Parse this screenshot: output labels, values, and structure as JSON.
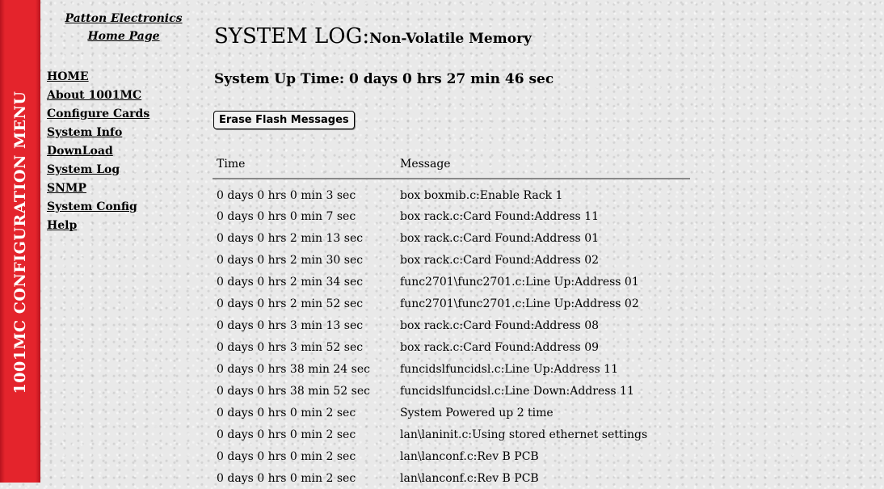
{
  "sidebar": {
    "banner": "1001MC CONFIGURATION MENU",
    "home_link_line1": "Patton Electronics",
    "home_link_line2": "Home Page",
    "nav_items": [
      {
        "label": "HOME"
      },
      {
        "label": "About 1001MC"
      },
      {
        "label": "Configure Cards"
      },
      {
        "label": "System Info"
      },
      {
        "label": "DownLoad"
      },
      {
        "label": "System Log"
      },
      {
        "label": "SNMP"
      },
      {
        "label": "System Config"
      },
      {
        "label": "Help"
      }
    ]
  },
  "main": {
    "title": "SYSTEM LOG:",
    "title_sub": "Non-Volatile Memory",
    "uptime": "System Up Time: 0 days 0 hrs 27 min 46 sec",
    "erase_button_label": "Erase Flash Messages",
    "table": {
      "headers": {
        "time": "Time",
        "message": "Message"
      },
      "rows": [
        {
          "time": "0 days 0 hrs 0 min 3 sec",
          "message": "box boxmib.c:Enable Rack 1"
        },
        {
          "time": "0 days 0 hrs 0 min 7 sec",
          "message": "box rack.c:Card Found:Address 11"
        },
        {
          "time": "0 days 0 hrs 2 min 13 sec",
          "message": "box rack.c:Card Found:Address 01"
        },
        {
          "time": "0 days 0 hrs 2 min 30 sec",
          "message": "box rack.c:Card Found:Address 02"
        },
        {
          "time": "0 days 0 hrs 2 min 34 sec",
          "message": "func2701\\func2701.c:Line Up:Address 01"
        },
        {
          "time": "0 days 0 hrs 2 min 52 sec",
          "message": "func2701\\func2701.c:Line Up:Address 02"
        },
        {
          "time": "0 days 0 hrs 3 min 13 sec",
          "message": "box rack.c:Card Found:Address 08"
        },
        {
          "time": "0 days 0 hrs 3 min 52 sec",
          "message": "box rack.c:Card Found:Address 09"
        },
        {
          "time": "0 days 0 hrs 38 min 24 sec",
          "message": "funcidslfuncidsl.c:Line Up:Address 11"
        },
        {
          "time": "0 days 0 hrs 38 min 52 sec",
          "message": "funcidslfuncidsl.c:Line Down:Address 11"
        },
        {
          "time": "0 days 0 hrs 0 min 2 sec",
          "message": "System Powered up 2 time"
        },
        {
          "time": "0 days 0 hrs 0 min 2 sec",
          "message": "lan\\laninit.c:Using stored ethernet settings"
        },
        {
          "time": "0 days 0 hrs 0 min 2 sec",
          "message": "lan\\lanconf.c:Rev B PCB"
        },
        {
          "time": "0 days 0 hrs 0 min 2 sec",
          "message": "lan\\lanconf.c:Rev B PCB"
        }
      ]
    }
  },
  "colors": {
    "sidebar_red": "#e4242c",
    "background": "#e9e9e9"
  }
}
